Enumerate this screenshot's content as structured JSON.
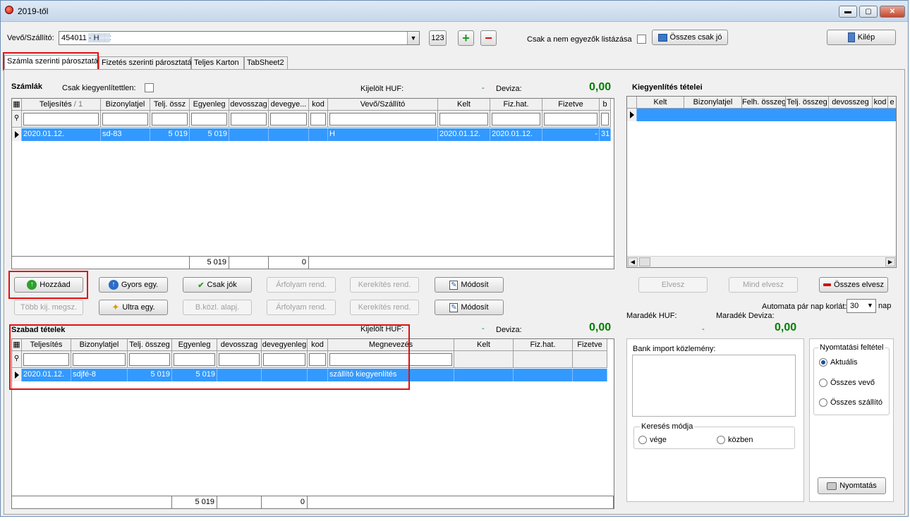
{
  "window": {
    "title": "2019-től",
    "minimize": "▬",
    "maximize": "▢",
    "close": "✕"
  },
  "toolbar": {
    "partner_label": "Vevő/Szállító:",
    "partner_value": "454011 - H",
    "btn_123": "123",
    "btn_plus": "+",
    "btn_minus": "−",
    "only_nonmatching_label": "Csak a nem egyezők listázása",
    "all_ok_button": "Összes csak jó",
    "exit_button": "Kilép"
  },
  "tabs": [
    "Számla szerinti párosztatás",
    "Fizetés szerinti párosztatás",
    "Teljes Karton",
    "TabSheet2"
  ],
  "szamlak": {
    "title": "Számlák",
    "only_unsettled_label": "Csak kiegyenlítettlen:",
    "selected_huf_label": "Kijelölt HUF:",
    "selected_huf_value": "-",
    "deviza_label": "Deviza:",
    "deviza_value": "0,00",
    "columns": [
      "",
      "Teljesítés",
      "Bizonylatjel",
      "Telj. össz",
      "Egyenleg",
      "devosszag",
      "devegye...",
      "kod",
      "Vevő/Szállító",
      "Kelt",
      "Fiz.hat.",
      "Fizetve",
      "b"
    ],
    "sort_mark": "/ 1",
    "rows": [
      [
        "",
        "2020.01.12.",
        "sd-83",
        "5 019",
        "5 019",
        "",
        "",
        "",
        "H",
        "2020.01.12.",
        "2020.01.12.",
        "-",
        "31"
      ]
    ],
    "footer": {
      "telj_sum": "5 019",
      "devegy_sum": "0"
    }
  },
  "buttons_row1": {
    "hozzaad": "Hozzáad",
    "gyors": "Gyors egy.",
    "csak_jok": "Csak jók",
    "arfolyam": "Árfolyam rend.",
    "kerekites": "Kerekítés rend.",
    "modosit": "Módosít"
  },
  "buttons_row2": {
    "tobb_kij": "Több kij. megsz.",
    "ultra": "Ultra egy.",
    "bkozl": "B.közl. alapj.",
    "arfolyam": "Árfolyam rend.",
    "kerekites": "Kerekítés rend.",
    "modosit": "Módosít"
  },
  "szabad": {
    "title": "Szabad tételek",
    "selected_huf_label": "Kijelölt HUF:",
    "selected_huf_value": "-",
    "deviza_label": "Deviza:",
    "deviza_value": "0,00",
    "columns": [
      "",
      "Teljesítés",
      "Bizonylatjel",
      "Telj. összeg",
      "Egyenleg",
      "devosszag",
      "devegyenleg",
      "kod",
      "Megnevezés",
      "Kelt",
      "Fiz.hat.",
      "Fizetve"
    ],
    "rows": [
      [
        "",
        "2020.01.12.",
        "sdjfé-8",
        "5 019",
        "5 019",
        "",
        "",
        "",
        "szállító kiegyenlítés",
        "",
        "",
        ""
      ]
    ],
    "footer": {
      "telj_sum": "5 019",
      "devegy_sum": "0"
    }
  },
  "kiegyenlites": {
    "title": "Kiegyenlítés tételei",
    "columns": [
      "",
      "Kelt",
      "Bizonylatjel",
      "Felh. összeg",
      "Telj. összeg",
      "devosszeg",
      "kod",
      "e"
    ],
    "elvesz": "Elvesz",
    "mind_elvesz": "Mind elvesz",
    "osszes_elvesz": "Összes elvesz",
    "auto_label": "Automata pár nap korlát:",
    "auto_value": "30",
    "auto_unit": "nap",
    "maradek_huf_label": "Maradék HUF:",
    "maradek_huf_value": "-",
    "maradek_deviza_label": "Maradék Deviza:",
    "maradek_deviza_value": "0,00"
  },
  "bank": {
    "import_label": "Bank import közlemény:",
    "search_mode_label": "Keresés módja",
    "mode_end": "vége",
    "mode_within": "közben"
  },
  "print": {
    "group_label": "Nyomtatási feltétel",
    "opt_current": "Aktuális",
    "opt_all_customers": "Összes vevő",
    "opt_all_suppliers": "Összes szállító",
    "print_button": "Nyomtatás"
  }
}
